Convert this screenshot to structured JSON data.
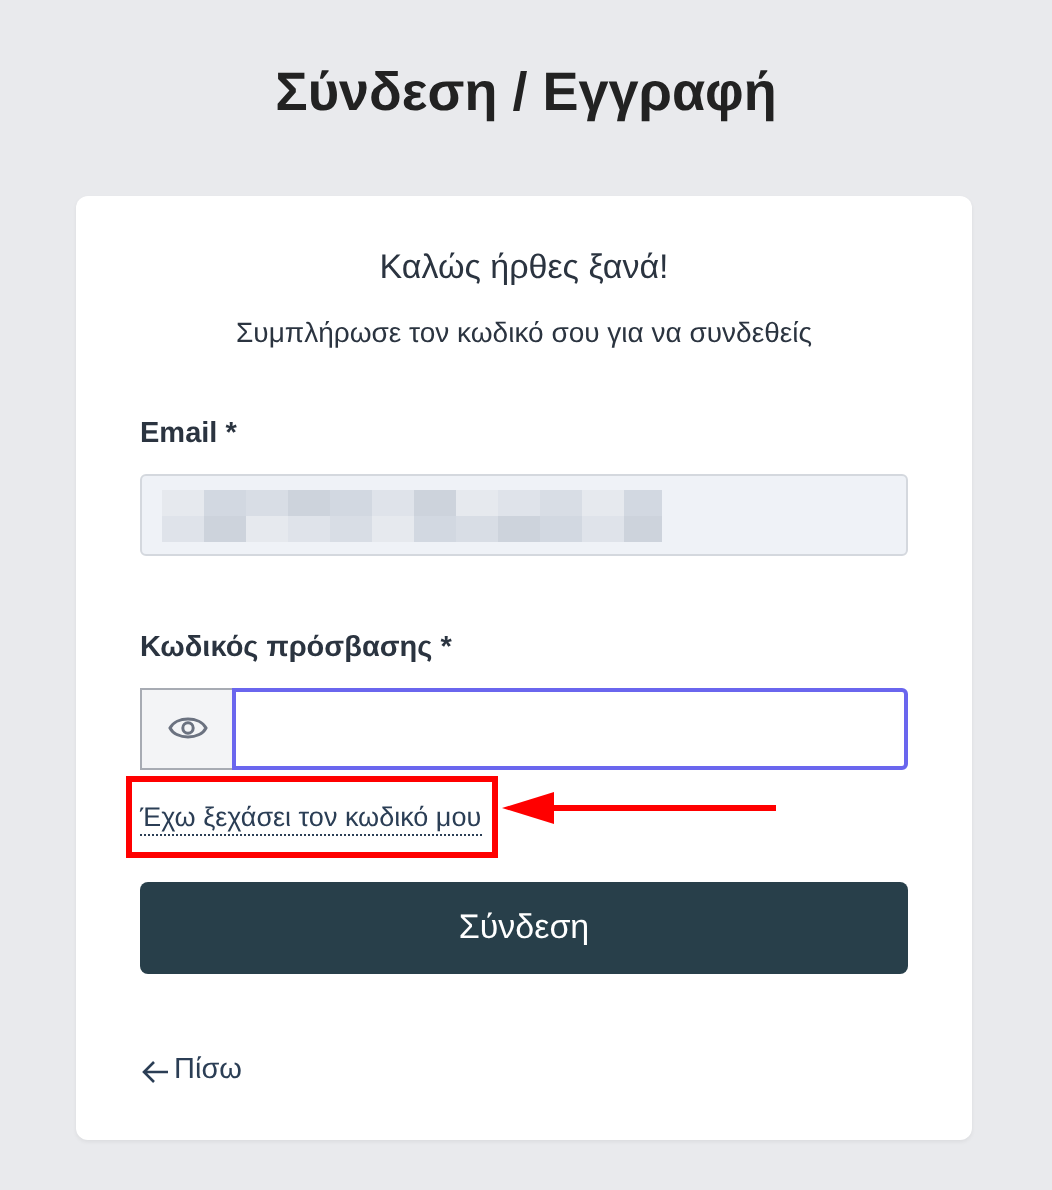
{
  "page": {
    "title": "Σύνδεση / Εγγραφή"
  },
  "card": {
    "heading": "Καλώς ήρθες ξανά!",
    "subtitle": "Συμπλήρωσε τον κωδικό σου για να συνδεθείς",
    "fields": [
      {
        "kind": "email",
        "label": "Email *",
        "redacted": true,
        "focused": false
      },
      {
        "kind": "password",
        "label": "Κωδικός πρόσβασης *",
        "focused": true
      }
    ],
    "forgot_link": "Έχω ξεχάσει τον κωδικό μου",
    "submit": "Σύνδεση",
    "back_link": "Πίσω"
  },
  "annotation": {
    "kind": "box-and-arrow"
  }
}
